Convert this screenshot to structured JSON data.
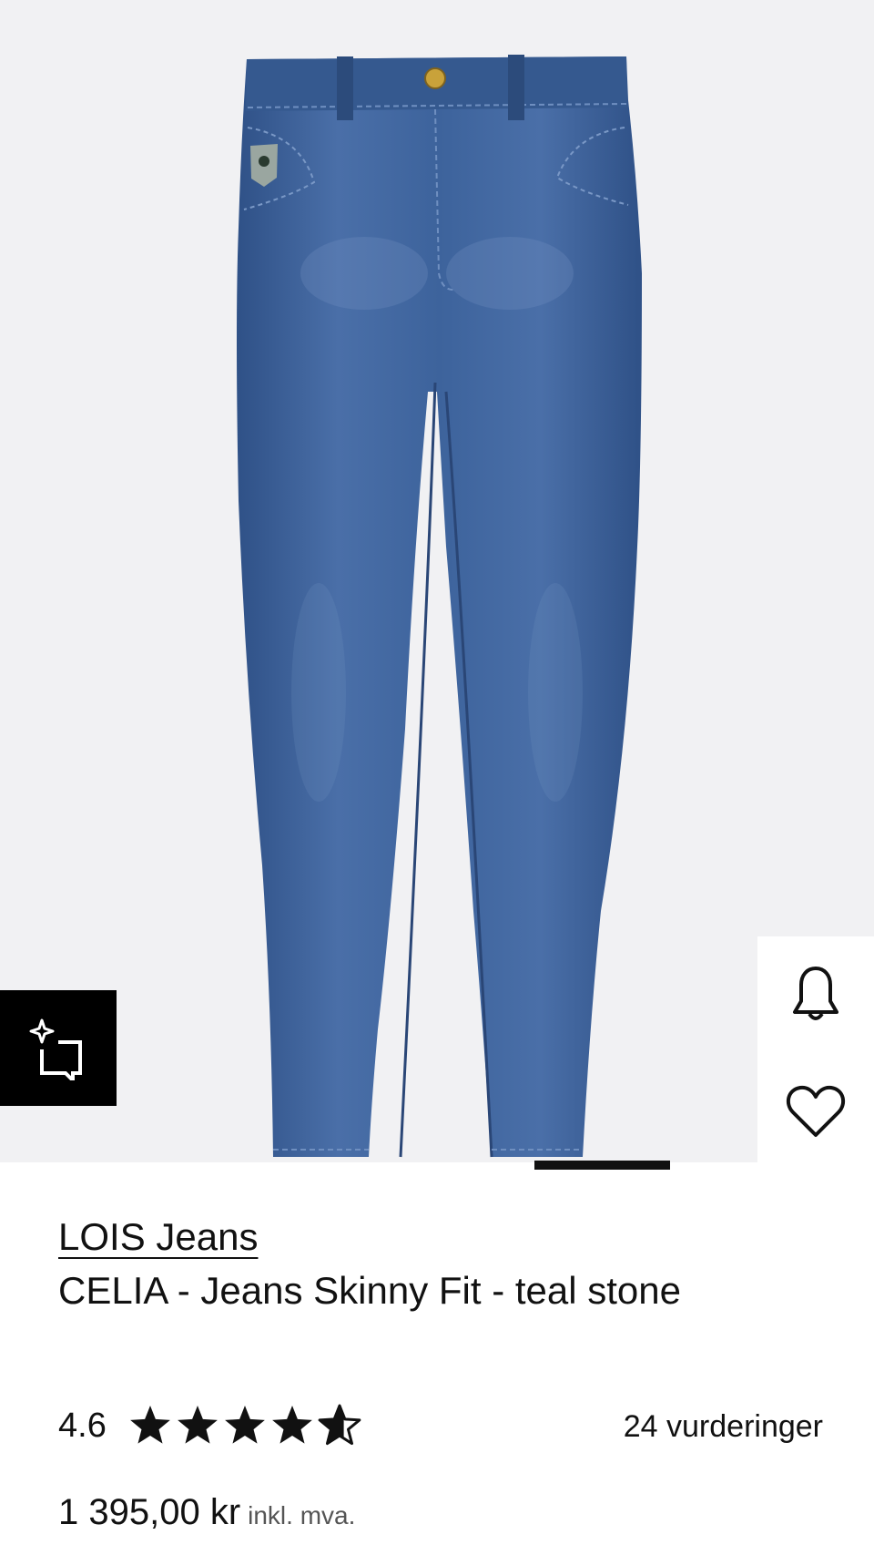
{
  "product_image": {
    "alt": "",
    "colors": {
      "background": "#f1f1f3",
      "denim": "#3f649d",
      "denim_dark": "#2c4b7b",
      "button": "#c9a23a"
    }
  },
  "icons": {
    "try_on": "sparkle-frame-icon",
    "notify": "bell-icon",
    "wishlist": "heart-icon",
    "rating_star": "star-icon"
  },
  "carousel": {
    "active_index": 2,
    "total": 5
  },
  "product": {
    "brand": "LOIS Jeans",
    "name": "CELIA - Jeans Skinny Fit - teal stone",
    "rating": "4.6",
    "rating_value": 4.6,
    "rating_max": 5,
    "review_count": "24 vurderinger",
    "price": "1 395,00 kr",
    "vat_note": "inkl. mva."
  }
}
